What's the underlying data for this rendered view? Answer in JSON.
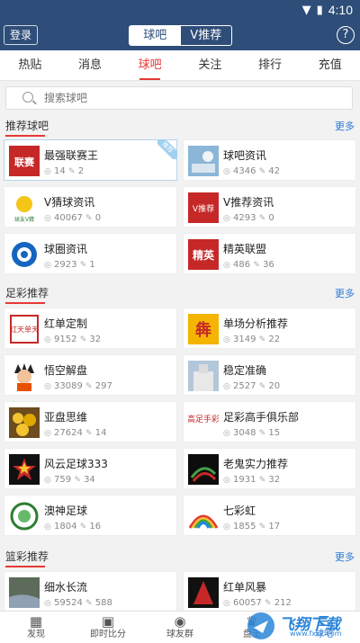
{
  "status_bar": {
    "time": "4:10"
  },
  "header": {
    "login_label": "登录",
    "segments": [
      "球吧",
      "V推荐"
    ],
    "help_label": "?"
  },
  "tabs": [
    "热贴",
    "消息",
    "球吧",
    "关注",
    "排行",
    "充值"
  ],
  "active_tab": "球吧",
  "search": {
    "placeholder": "搜索球吧"
  },
  "sections": [
    {
      "title": "推荐球吧",
      "more": "更多",
      "items": [
        {
          "name": "最强联赛王",
          "members": "14",
          "posts": "2",
          "badge": "推荐"
        },
        {
          "name": "球吧资讯",
          "members": "4346",
          "posts": "42"
        },
        {
          "name": "V猜球资讯",
          "members": "40067",
          "posts": "0"
        },
        {
          "name": "V推荐资讯",
          "members": "4293",
          "posts": "0"
        },
        {
          "name": "球圈资讯",
          "members": "2923",
          "posts": "1"
        },
        {
          "name": "精英联盟",
          "members": "486",
          "posts": "36"
        }
      ]
    },
    {
      "title": "足彩推荐",
      "more": "更多",
      "items": [
        {
          "name": "红单定制",
          "members": "9152",
          "posts": "32"
        },
        {
          "name": "单场分析推荐",
          "members": "3149",
          "posts": "22"
        },
        {
          "name": "悟空解盘",
          "members": "33089",
          "posts": "297"
        },
        {
          "name": "稳定准确",
          "members": "2527",
          "posts": "20"
        },
        {
          "name": "亚盘思维",
          "members": "27624",
          "posts": "14"
        },
        {
          "name": "足彩高手俱乐部",
          "members": "3048",
          "posts": "15"
        },
        {
          "name": "风云足球333",
          "members": "759",
          "posts": "34"
        },
        {
          "name": "老鬼实力推荐",
          "members": "1931",
          "posts": "32"
        },
        {
          "name": "澳神足球",
          "members": "1804",
          "posts": "16"
        },
        {
          "name": "七彩虹",
          "members": "1855",
          "posts": "17"
        }
      ]
    },
    {
      "title": "篮彩推荐",
      "more": "更多",
      "items": [
        {
          "name": "细水长流",
          "members": "59524",
          "posts": "588"
        },
        {
          "name": "红单风暴",
          "members": "60057",
          "posts": "212"
        }
      ]
    }
  ],
  "thumb_text": {
    "liansai": "联赛",
    "vtuijian": "V推荐",
    "jingying": "精英",
    "qiuyouv": "球友V猜",
    "hongdan": "红天单天",
    "gaozu": "高足手彩"
  },
  "bottom_nav": [
    {
      "label": "发现",
      "icon": "grid-icon"
    },
    {
      "label": "即时比分",
      "icon": "calendar-icon"
    },
    {
      "label": "球友群",
      "icon": "ball-icon"
    },
    {
      "label": "盘王",
      "icon": "crown-icon"
    },
    {
      "label": "球吧",
      "icon": "forum-icon",
      "active": true
    }
  ],
  "watermark": {
    "text": "飞翔下载",
    "url": "www.fxxz.com"
  },
  "colors": {
    "header": "#2e4d78",
    "accent": "#e53935",
    "link": "#2b7bd6"
  }
}
